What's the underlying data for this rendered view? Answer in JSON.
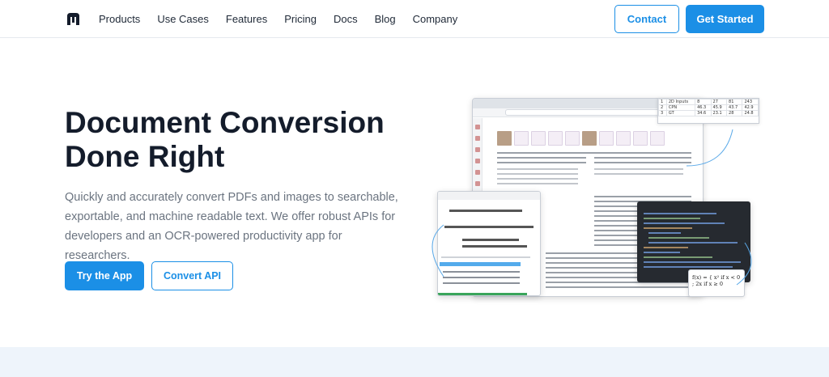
{
  "nav": {
    "items": [
      "Products",
      "Use Cases",
      "Features",
      "Pricing",
      "Docs",
      "Blog",
      "Company"
    ],
    "contact_label": "Contact",
    "get_started_label": "Get Started"
  },
  "hero": {
    "title_line1": "Document Conversion",
    "title_line2": "Done Right",
    "description": "Quickly and accurately convert PDFs and images to searchable, exportable, and machine readable text. We offer robust APIs for developers and an OCR-powered productivity app for researchers.",
    "try_app_label": "Try the App",
    "convert_api_label": "Convert API"
  },
  "illustration": {
    "spreadsheet": {
      "rows": [
        [
          "1",
          "2D Inputs",
          "8",
          "27",
          "81",
          "243"
        ],
        [
          "2",
          "CPN",
          "46.3",
          "45.9",
          "43.7",
          "42.9"
        ],
        [
          "3",
          "GT",
          "34.6",
          "23.1",
          "28",
          "24.8"
        ]
      ]
    },
    "formula_text": "f(x) = { x² if x < 0 ; 2x if x ≥ 0"
  },
  "colors": {
    "primary": "#1b8fe6",
    "heading": "#141c2b",
    "body_text": "#6b7480",
    "band": "#eef4fb"
  }
}
